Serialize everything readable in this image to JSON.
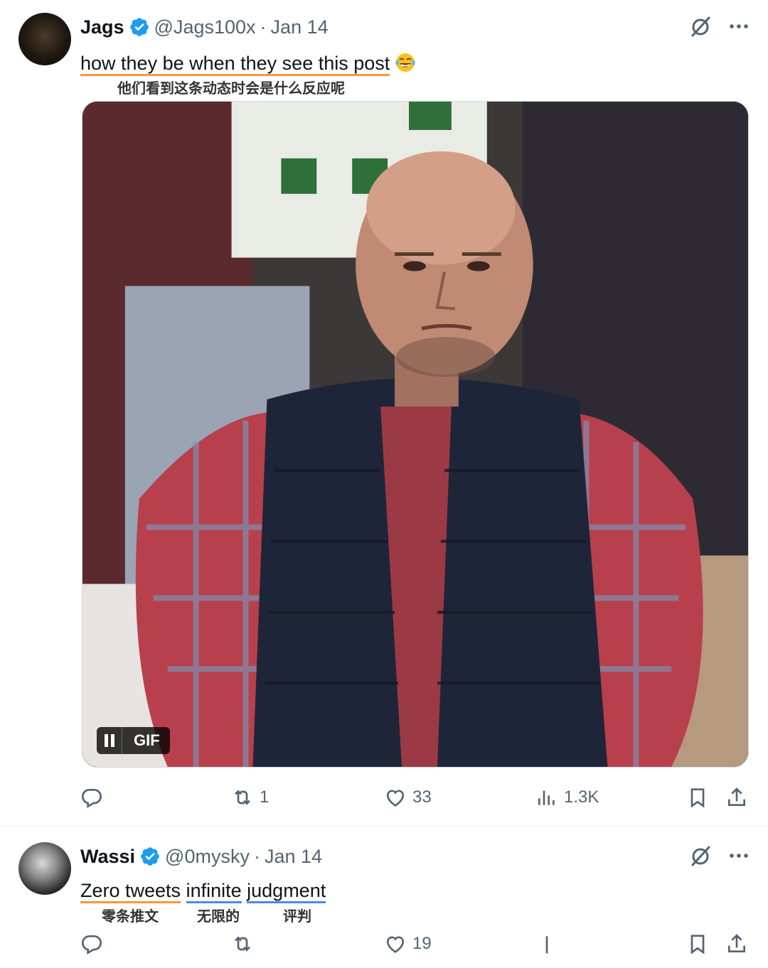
{
  "tweets": [
    {
      "name": "Jags",
      "handle": "@Jags100x",
      "separator": "·",
      "date": "Jan 14",
      "text_parts": [
        "how they be when they see this post"
      ],
      "emoji": "face-with-tears-of-joy",
      "translation": "他们看到这条动态时会是什么反应呢",
      "media": {
        "type": "GIF",
        "badge_label": "GIF",
        "pause_icon": "pause-icon"
      },
      "stats": {
        "replies": "",
        "reposts": "1",
        "likes": "33",
        "views": "1.3K"
      }
    },
    {
      "name": "Wassi",
      "handle": "@0mysky",
      "separator": "·",
      "date": "Jan 14",
      "text_parts": [
        "Zero tweets",
        "infinite",
        "judgment"
      ],
      "translations": [
        "零条推文",
        "无限的",
        "评判"
      ],
      "stats": {
        "replies": "",
        "reposts": "",
        "likes": "19",
        "views": ""
      }
    }
  ],
  "icons": {
    "verified": "verified-badge-icon",
    "grok": "grok-icon",
    "more": "more-icon",
    "reply": "reply-icon",
    "repost": "repost-icon",
    "like": "like-icon",
    "views": "views-icon",
    "bookmark": "bookmark-icon",
    "share": "share-icon"
  },
  "colors": {
    "verified_blue": "#1d9bf0",
    "secondary_text": "#536471",
    "underline_orange": "#f39a3a",
    "underline_blue": "#4a8be6"
  }
}
